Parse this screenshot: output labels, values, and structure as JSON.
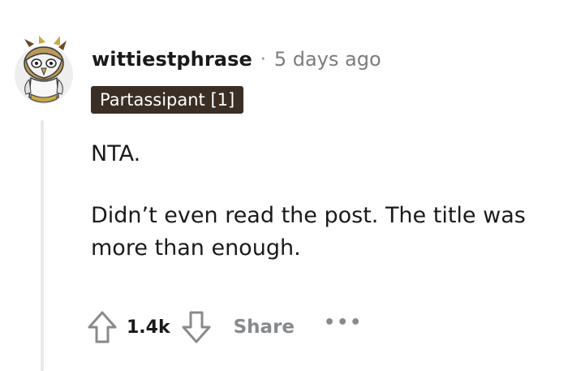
{
  "comment": {
    "author": "wittiestphrase",
    "separator": "·",
    "time": "5 days ago",
    "flair": "Partassipant [1]",
    "paragraphs": [
      "NTA.",
      "Didn’t even read the post. The title was more than enough."
    ]
  },
  "actions": {
    "upvote_icon": "upvote-arrow-icon",
    "vote_count": "1.4k",
    "downvote_icon": "downvote-arrow-icon",
    "share_label": "Share",
    "more_icon": "more-options-icon",
    "more_label": "•••"
  },
  "colors": {
    "flair_background": "#3a2e25",
    "muted_text": "#878a8c",
    "thread_line": "#e8e9ea",
    "avatar_accent": "#c8a84b"
  }
}
